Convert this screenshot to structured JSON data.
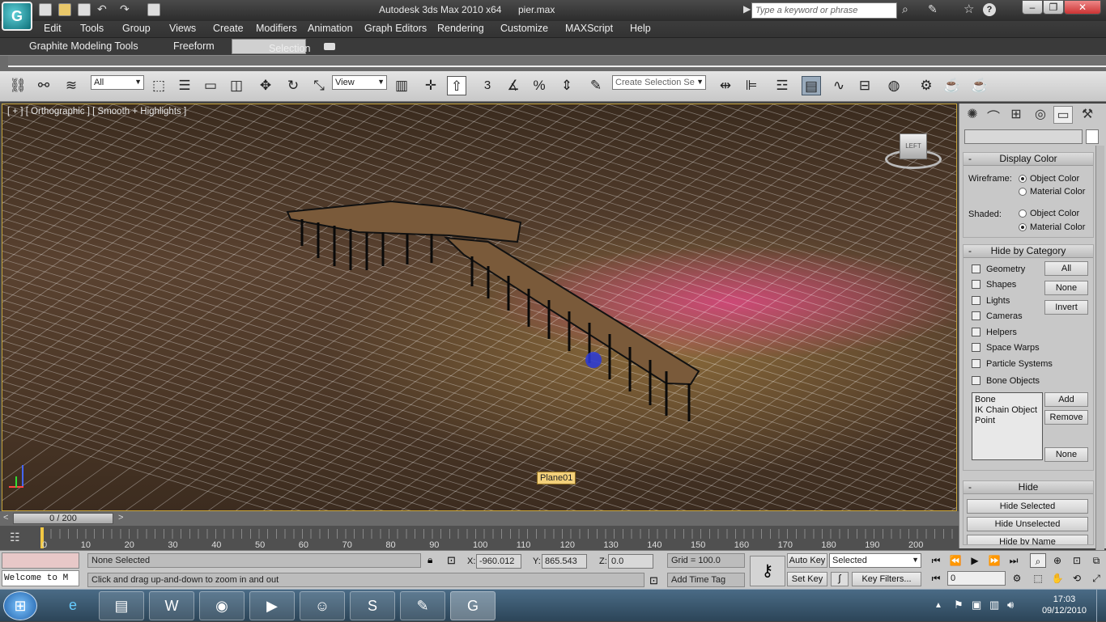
{
  "title": {
    "app": "Autodesk 3ds Max  2010 x64",
    "file": "pier.max",
    "search_placeholder": "Type a keyword or phrase"
  },
  "menu": [
    "Edit",
    "Tools",
    "Group",
    "Views",
    "Create",
    "Modifiers",
    "Animation",
    "Graph Editors",
    "Rendering",
    "Customize",
    "MAXScript",
    "Help"
  ],
  "ribbon": {
    "tabs": [
      "Graphite Modeling Tools",
      "Freeform",
      "Selection"
    ],
    "active": "Selection"
  },
  "toolbar": {
    "filter_value": "All",
    "refcoord_value": "View",
    "snap_label": "3",
    "named_selection_placeholder": "Create Selection Se"
  },
  "viewport": {
    "label": "[ + ] [ Orthographic ] [ Smooth + Highlights ]",
    "tooltip": "Plane01",
    "viewcube_label": "LEFT"
  },
  "panel": {
    "display_color": {
      "title": "Display Color",
      "wireframe": "Wireframe:",
      "shaded": "Shaded:",
      "object_color": "Object Color",
      "material_color": "Material Color"
    },
    "hide_by_category": {
      "title": "Hide by Category",
      "items": [
        "Geometry",
        "Shapes",
        "Lights",
        "Cameras",
        "Helpers",
        "Space Warps",
        "Particle Systems",
        "Bone Objects"
      ],
      "all": "All",
      "none": "None",
      "invert": "Invert",
      "list": [
        "Bone",
        "IK Chain Object",
        "Point"
      ],
      "add": "Add",
      "remove": "Remove",
      "none2": "None"
    },
    "hide": {
      "title": "Hide",
      "hide_selected": "Hide Selected",
      "hide_unselected": "Hide Unselected",
      "hide_by_name": "Hide by Name"
    }
  },
  "timeslider": {
    "value": "0 / 200"
  },
  "trackbar": {
    "ticks": [
      "0",
      "10",
      "20",
      "30",
      "40",
      "50",
      "60",
      "70",
      "80",
      "90",
      "100",
      "110",
      "120",
      "130",
      "140",
      "150",
      "160",
      "170",
      "180",
      "190",
      "200"
    ]
  },
  "status": {
    "listener": "Welcome to M",
    "selection": "None Selected",
    "prompt": "Click and drag up-and-down to zoom in and out",
    "x_label": "X:",
    "x": "-960.012",
    "y_label": "Y:",
    "y": "865.543",
    "z_label": "Z:",
    "z": "0.0",
    "grid": "Grid = 100.0",
    "add_time_tag": "Add Time Tag",
    "auto_key": "Auto Key",
    "set_key": "Set Key",
    "key_mode": "Selected",
    "key_filters": "Key Filters...",
    "frame": "0"
  },
  "taskbar": {
    "time": "17:03",
    "date": "09/12/2010"
  }
}
